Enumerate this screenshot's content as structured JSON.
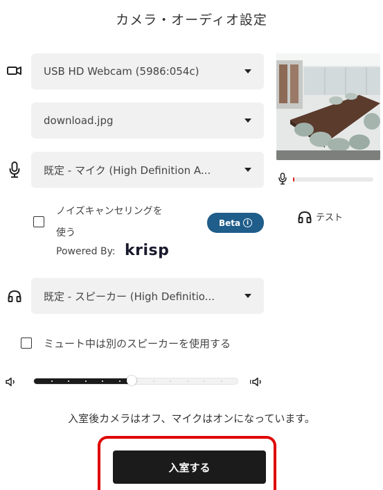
{
  "title": "カメラ・オーディオ設定",
  "camera": {
    "selected": "USB HD Webcam (5986:054c)"
  },
  "background": {
    "selected": "download.jpg"
  },
  "microphone": {
    "selected": "既定 - マイク (High Definition A..."
  },
  "noise_cancel": {
    "label_line1": "ノイズキャンセリングを",
    "label_line2": "使う",
    "checked": false,
    "beta_label": "Beta",
    "powered_by": "Powered By:",
    "brand": "krisp"
  },
  "speaker": {
    "selected": "既定 - スピーカー (High Definitio..."
  },
  "test": {
    "label": "テスト"
  },
  "mute_speaker": {
    "label": "ミュート中は別のスピーカーを使用する",
    "checked": false
  },
  "volume": {
    "level": 0.48,
    "accent": "#1b1b1b"
  },
  "status_text": "入室後カメラはオフ、マイクはオンになっています。",
  "enter_button": {
    "label": "入室する"
  },
  "mic_level": {
    "level": 0.01,
    "color": "#e02020"
  },
  "colors": {
    "highlight": "#e00000",
    "beta_bg": "#1f5d8a",
    "select_bg": "#f1f1f1"
  }
}
